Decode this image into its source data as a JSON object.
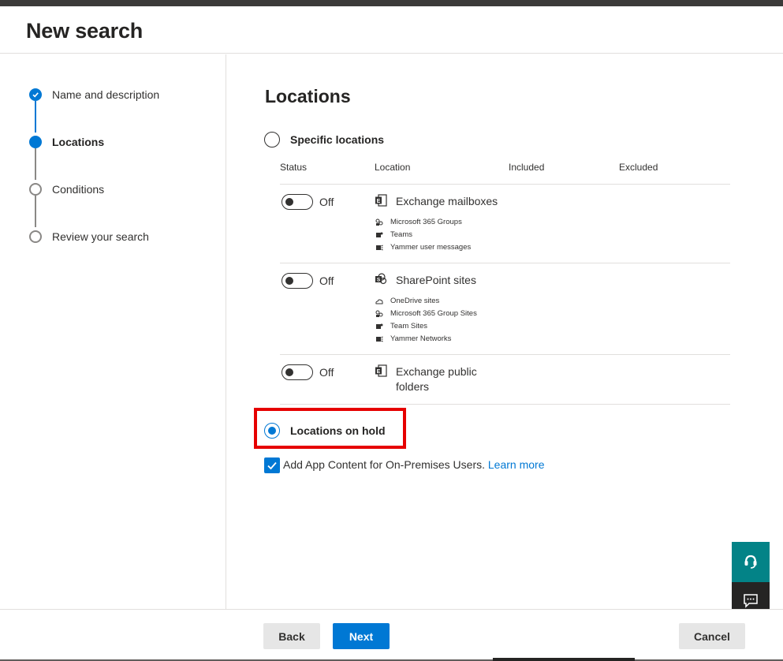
{
  "page": {
    "title": "New search"
  },
  "steps": [
    {
      "label": "Name and description",
      "state": "done"
    },
    {
      "label": "Locations",
      "state": "current"
    },
    {
      "label": "Conditions",
      "state": "todo"
    },
    {
      "label": "Review your search",
      "state": "todo"
    }
  ],
  "main": {
    "heading": "Locations",
    "specific_label": "Specific locations",
    "columns": {
      "status": "Status",
      "location": "Location",
      "included": "Included",
      "excluded": "Excluded"
    },
    "rows": [
      {
        "toggle": "Off",
        "title": "Exchange mailboxes",
        "icon": "exchange-icon",
        "subs": [
          {
            "icon": "groups-icon",
            "label": "Microsoft 365 Groups"
          },
          {
            "icon": "teams-icon",
            "label": "Teams"
          },
          {
            "icon": "yammer-icon",
            "label": "Yammer user messages"
          }
        ]
      },
      {
        "toggle": "Off",
        "title": "SharePoint sites",
        "icon": "sharepoint-icon",
        "subs": [
          {
            "icon": "onedrive-icon",
            "label": "OneDrive sites"
          },
          {
            "icon": "groups-icon",
            "label": "Microsoft 365 Group Sites"
          },
          {
            "icon": "teams-icon",
            "label": "Team Sites"
          },
          {
            "icon": "yammer-icon",
            "label": "Yammer Networks"
          }
        ]
      },
      {
        "toggle": "Off",
        "title_line1": "Exchange public",
        "title_line2": "folders",
        "icon": "exchange-icon"
      }
    ],
    "hold_label": "Locations on hold",
    "checkbox_label": "Add App Content for On-Premises Users.",
    "learn_more": "Learn more",
    "colors": {
      "accent": "#0078d4",
      "highlight": "#e60000",
      "help": "#038387"
    }
  },
  "footer": {
    "back": "Back",
    "next": "Next",
    "cancel": "Cancel"
  }
}
